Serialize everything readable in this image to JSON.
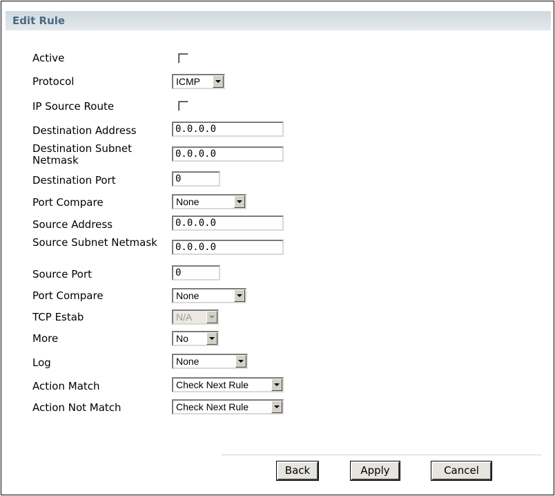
{
  "title": "Edit Rule",
  "fields": {
    "active": {
      "label": "Active",
      "checked": false
    },
    "protocol": {
      "label": "Protocol",
      "value": "ICMP"
    },
    "ip_source_route": {
      "label": "IP Source Route",
      "checked": false
    },
    "destination_address": {
      "label": "Destination Address",
      "value": "0.0.0.0"
    },
    "destination_subnet_netmask": {
      "label": "Destination Subnet Netmask",
      "value": "0.0.0.0"
    },
    "destination_port": {
      "label": "Destination Port",
      "value": "0"
    },
    "dest_port_compare": {
      "label": "Port Compare",
      "value": "None"
    },
    "source_address": {
      "label": "Source Address",
      "value": "0.0.0.0"
    },
    "source_subnet_netmask": {
      "label": "Source Subnet Netmask",
      "value": "0.0.0.0"
    },
    "source_port": {
      "label": "Source Port",
      "value": "0"
    },
    "src_port_compare": {
      "label": "Port Compare",
      "value": "None"
    },
    "tcp_estab": {
      "label": "TCP Estab",
      "value": "N/A",
      "disabled": true
    },
    "more": {
      "label": "More",
      "value": "No"
    },
    "log": {
      "label": "Log",
      "value": "None"
    },
    "action_match": {
      "label": "Action Match",
      "value": "Check Next Rule"
    },
    "action_not_match": {
      "label": "Action Not Match",
      "value": "Check Next Rule"
    }
  },
  "buttons": {
    "back": "Back",
    "apply": "Apply",
    "cancel": "Cancel"
  },
  "colors": {
    "title_text": "#4a6a80",
    "title_bar": "#d7e0e5"
  }
}
